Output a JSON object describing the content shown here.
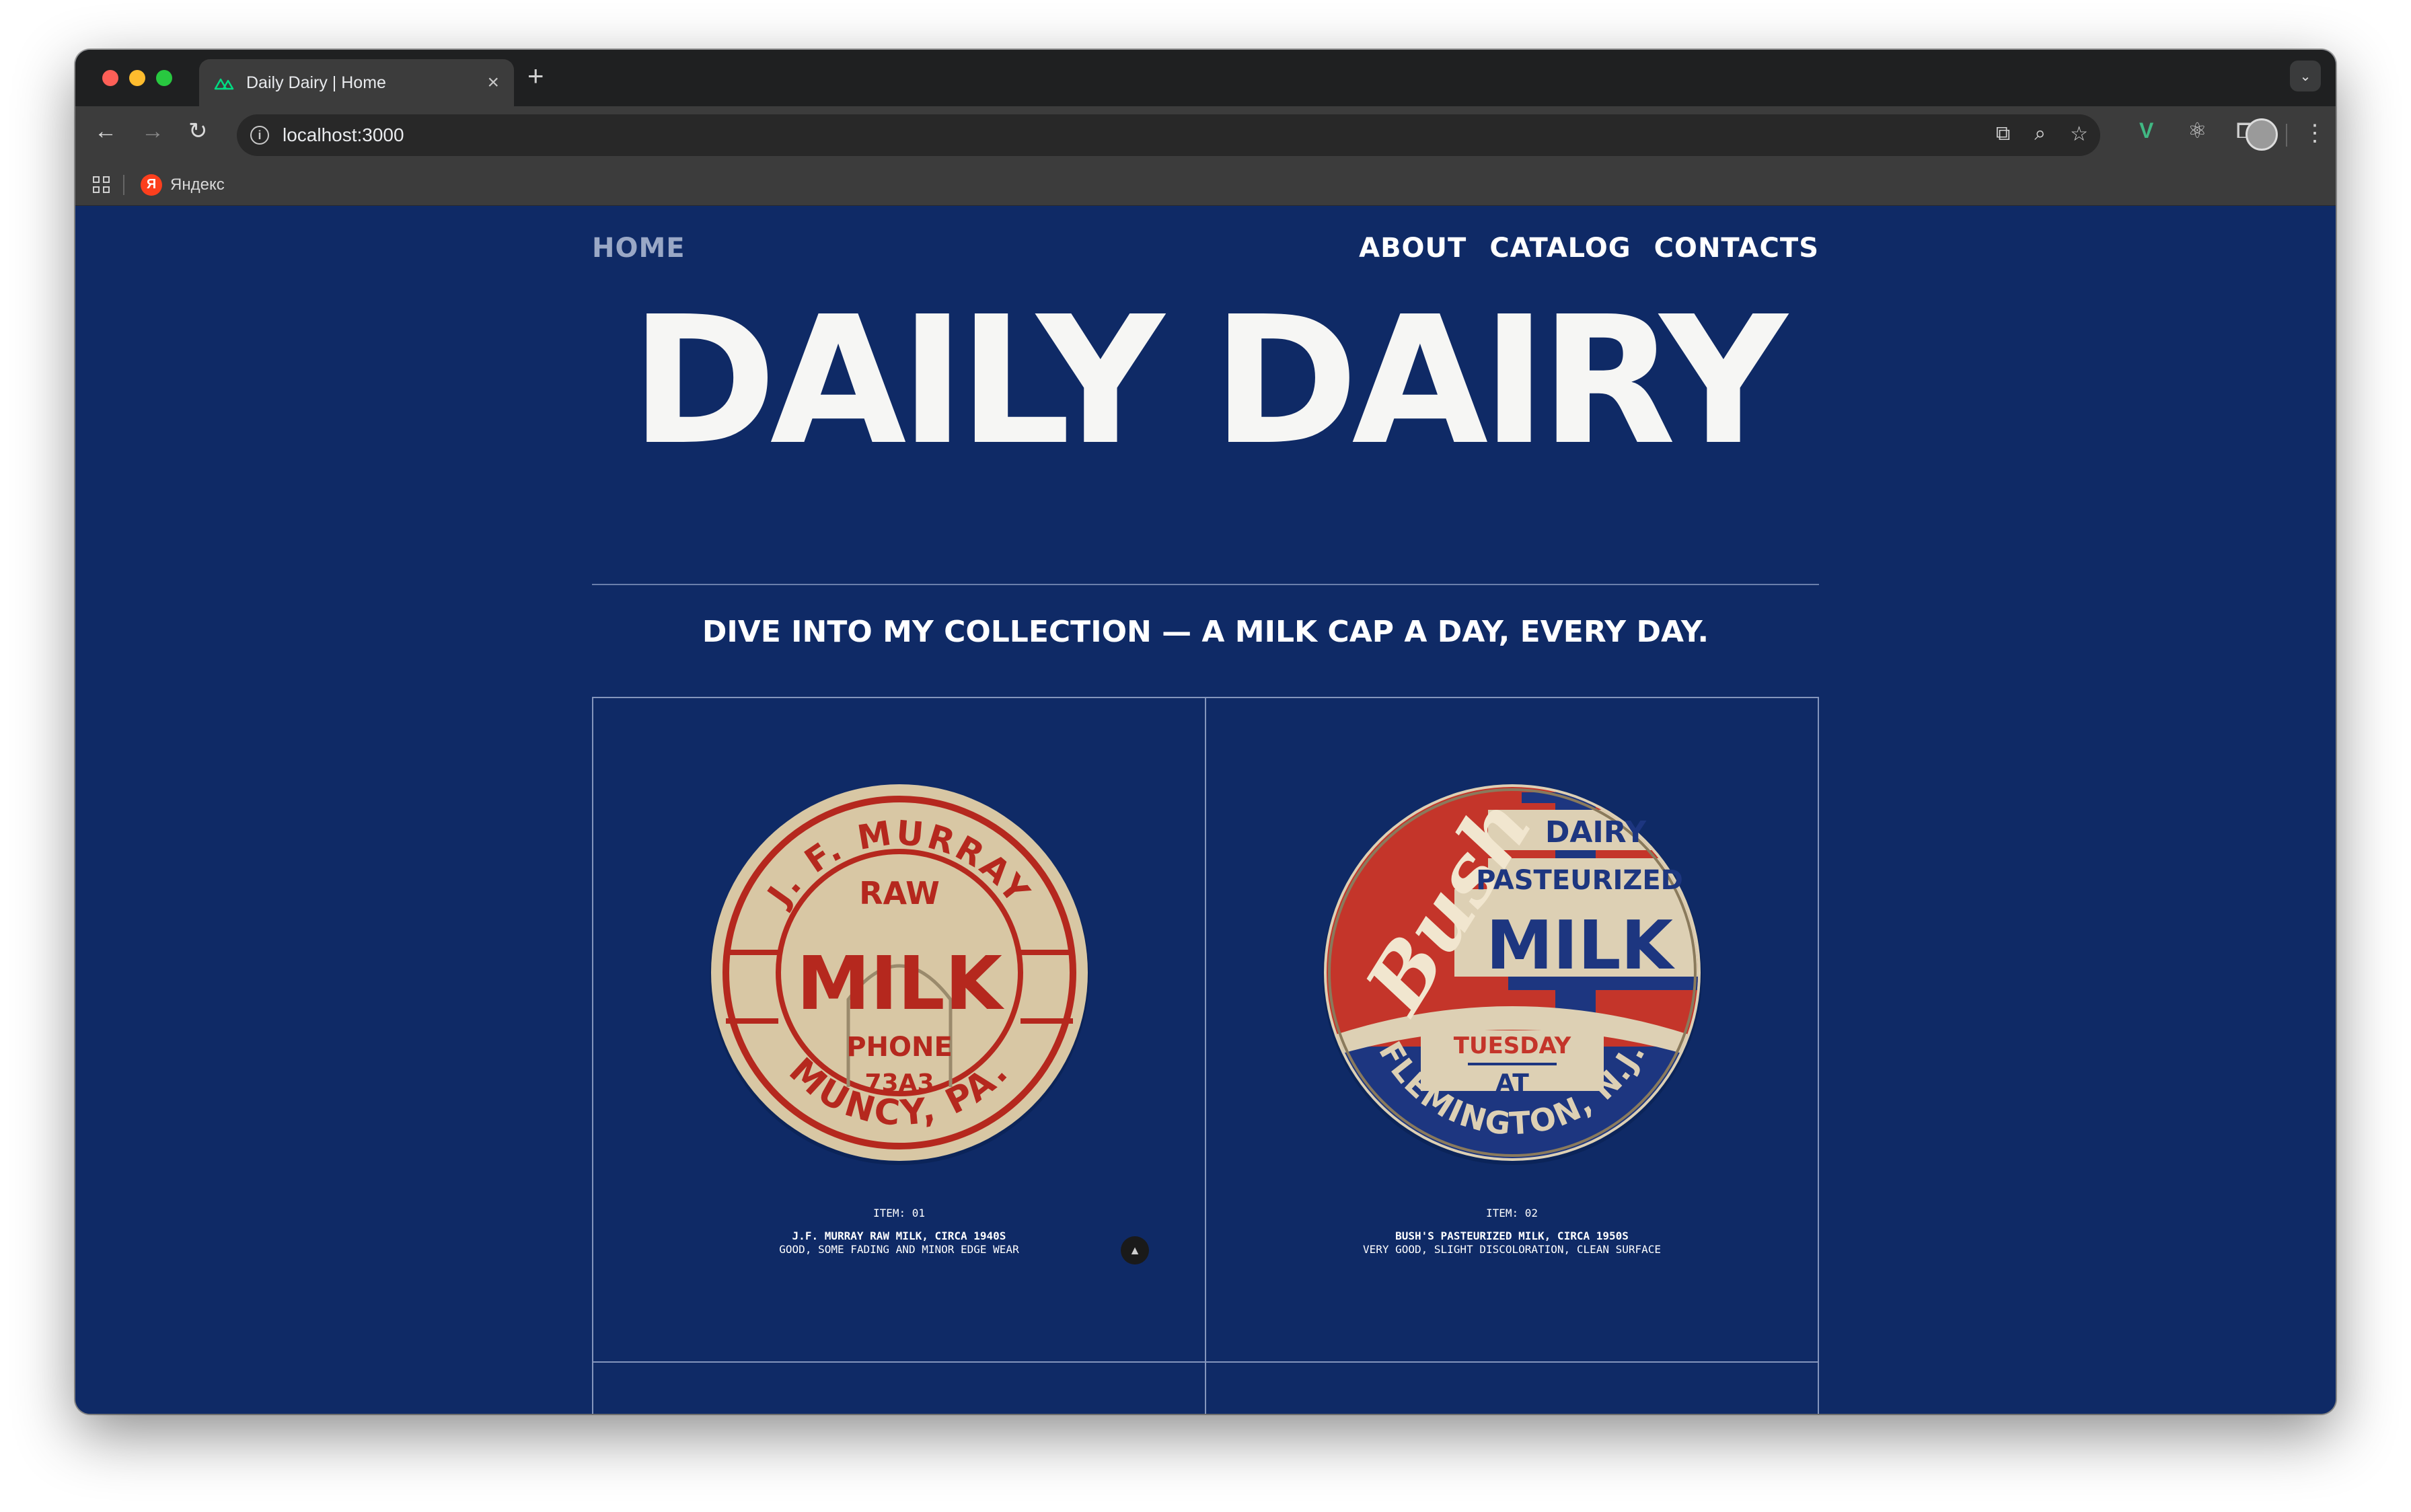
{
  "browser": {
    "tab_title": "Daily Dairy | Home",
    "tab_close": "×",
    "new_tab": "+",
    "tab_menu": "⌄",
    "url": "localhost:3000",
    "bookmark_label": "Яндекс",
    "bookmark_icon_letter": "Я"
  },
  "nav": {
    "home": "HOME",
    "links": [
      "ABOUT",
      "CATALOG",
      "CONTACTS"
    ]
  },
  "hero": {
    "title": "DAILY DAIRY",
    "tagline": "DIVE INTO MY COLLECTION — A MILK CAP A DAY, EVERY DAY."
  },
  "items": [
    {
      "item_no": "ITEM: 01",
      "name": "J.F. MURRAY RAW MILK, CIRCA 1940S",
      "condition": "GOOD, SOME FADING AND MINOR EDGE WEAR",
      "cap_text": {
        "arc_top": "J. F. MURRAY",
        "sub": "RAW",
        "main": "MILK",
        "phone": "PHONE",
        "number": "73A3",
        "arc_bottom": "MUNCY, PA."
      }
    },
    {
      "item_no": "ITEM: 02",
      "name": "BUSH'S PASTEURIZED MILK, CIRCA 1950S",
      "condition": "VERY GOOD, SLIGHT DISCOLORATION, CLEAN SURFACE",
      "cap_text": {
        "script": "Bush",
        "dairy": "DAIRY",
        "pasteurized": "PASTEURIZED",
        "main": "MILK",
        "day": "TUESDAY",
        "at": "AT",
        "arc_bottom": "FLEMINGTON, N.J."
      }
    }
  ],
  "colors": {
    "page_bg": "#0f2a66",
    "cap_paper": "#d9c8a6",
    "cap_red": "#b5281e",
    "cap_blue": "#1d3680"
  }
}
